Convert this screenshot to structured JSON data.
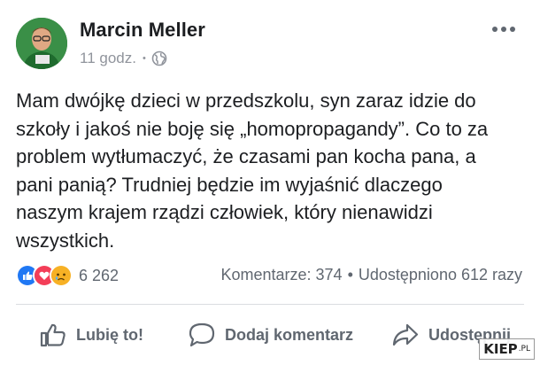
{
  "post": {
    "author": "Marcin Meller",
    "time": "11 godz.",
    "privacy_icon": "globe-icon",
    "more_icon": "more-options-icon",
    "text_lines": [
      "Mam dwójkę dzieci w przedszkolu, syn zaraz idzie do",
      "szkoły i jakoś nie boję się „homopropagandy”. Co to za",
      "problem wytłumaczyć, że czasami pan kocha pana, a",
      "pani panią? Trudniej będzie im wyjaśnić dlaczego",
      "naszym krajem rządzi człowiek, który nienawidzi",
      "wszystkich."
    ]
  },
  "stats": {
    "reactions": [
      "like-reaction-icon",
      "love-reaction-icon",
      "sad-reaction-icon"
    ],
    "reaction_count": "6 262",
    "comments": "Komentarze: 374",
    "shares": "Udostępniono 612 razy"
  },
  "actions": {
    "like": "Lubię to!",
    "comment": "Dodaj komentarz",
    "share": "Udostępnij"
  },
  "watermark": {
    "main": "KIEP",
    "suffix": ".PL"
  },
  "colors": {
    "text": "#1c1e21",
    "secondary": "#606770",
    "muted": "#90949c",
    "like_blue": "#2078f4",
    "love_red": "#f33e58",
    "sad_yellow": "#f7b125"
  }
}
